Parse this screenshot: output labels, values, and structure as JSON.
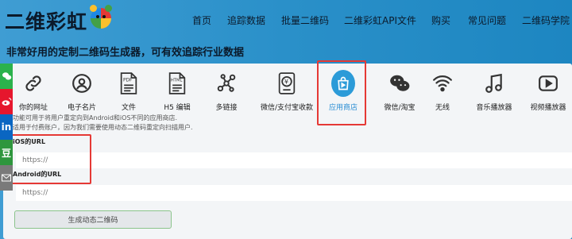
{
  "header": {
    "logo_text": "二维彩虹",
    "nav": [
      "首页",
      "追踪数据",
      "批量二维码",
      "二维彩虹API文件",
      "购买",
      "常见问题",
      "二维码学院"
    ]
  },
  "tagline": "非常好用的定制二维码生成器，可有效追踪行业数据",
  "tools": [
    {
      "label": "你的网址",
      "icon": "link-icon"
    },
    {
      "label": "电子名片",
      "icon": "person-icon"
    },
    {
      "label": "文件",
      "icon": "pdf-file-icon"
    },
    {
      "label": "H5 编辑",
      "icon": "html-file-icon"
    },
    {
      "label": "多链接",
      "icon": "multi-link-icon"
    },
    {
      "label": "微信/支付宝收款",
      "icon": "payment-icon"
    },
    {
      "label": "应用商店",
      "icon": "app-store-icon",
      "active": true
    },
    {
      "label": "微信/淘宝",
      "icon": "wechat-taobao-icon"
    },
    {
      "label": "无线",
      "icon": "wifi-icon"
    },
    {
      "label": "音乐播放器",
      "icon": "music-icon"
    },
    {
      "label": "视频播放器",
      "icon": "video-icon"
    }
  ],
  "form": {
    "note_line1": "此功能可用于将用户重定向到Android和iOS不同的应用商店.",
    "note_line2": "只适用于付费账户，因为我们需要使用动态二维码重定向扫描用户.",
    "ios_label": "iOS的URL",
    "ios_placeholder": "https://",
    "android_label": "Android的URL",
    "android_placeholder": "https://",
    "generate_button": "生成动态二维码"
  },
  "social": [
    {
      "icon": "wechat-icon",
      "color": "#2bb24c"
    },
    {
      "icon": "weibo-icon",
      "color": "#e6162d"
    },
    {
      "icon": "linkedin-icon",
      "color": "#0a66c2",
      "text": "in"
    },
    {
      "icon": "douban-icon",
      "color": "#2e963d",
      "text": "豆"
    },
    {
      "icon": "email-icon",
      "color": "#7a7a7a"
    }
  ],
  "colors": {
    "accent": "#2c9bd8",
    "highlight": "#e53935",
    "header_bg": "#2a90c9"
  }
}
